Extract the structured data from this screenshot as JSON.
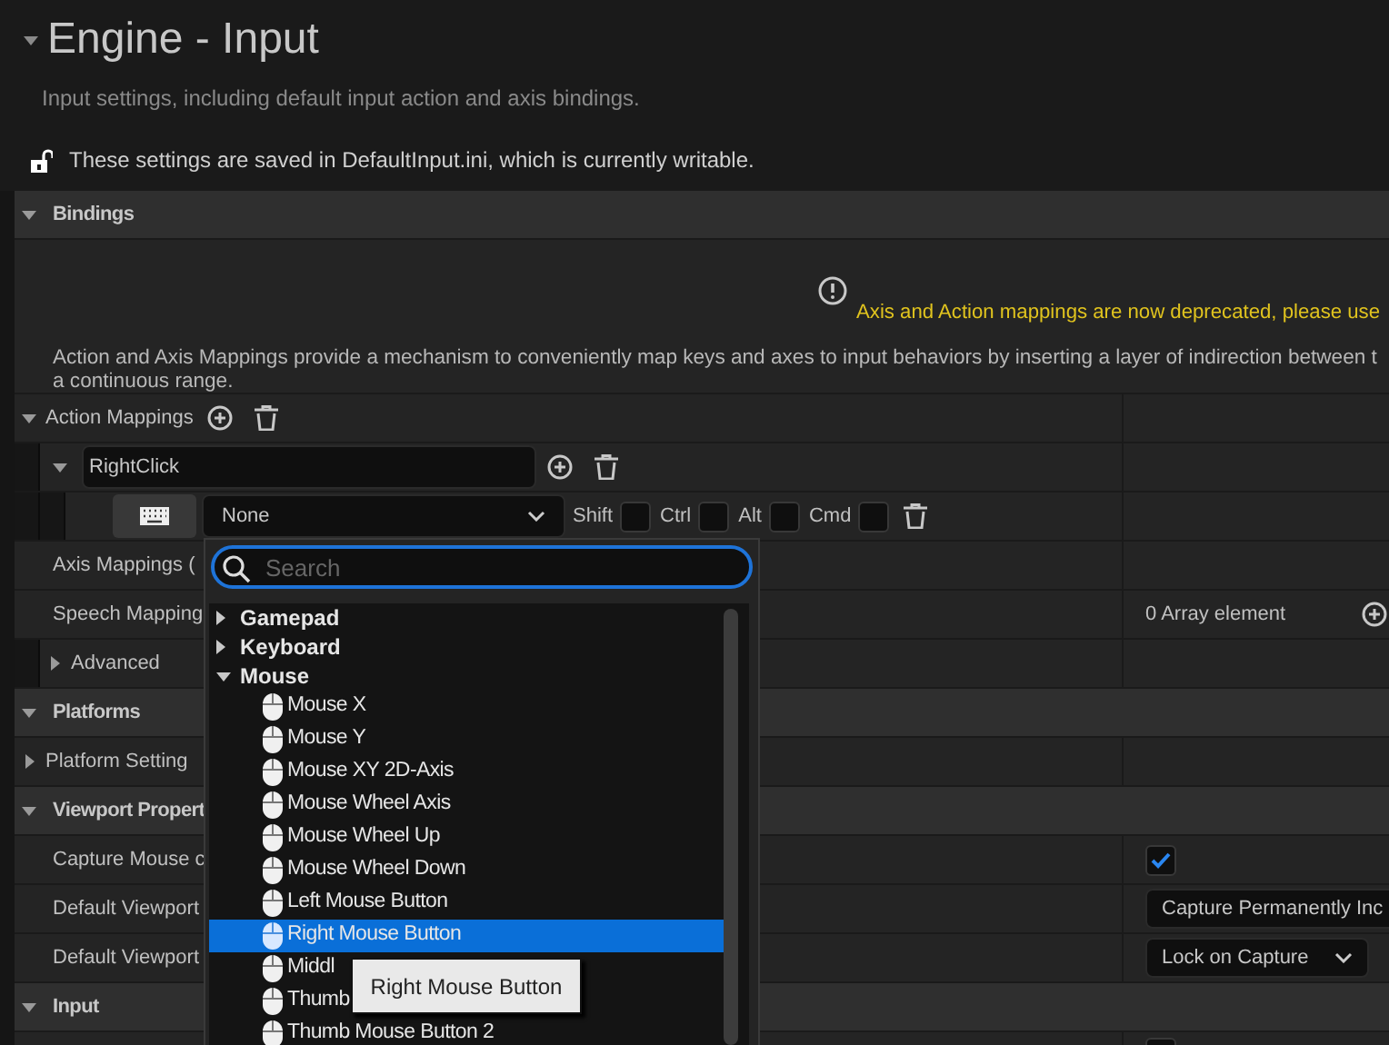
{
  "page": {
    "title": "Engine - Input",
    "expanded": true,
    "description": "Input settings, including default input action and axis bindings.",
    "status": "These settings are saved in DefaultInput.ini, which is currently writable.",
    "locked": false
  },
  "sections": [
    {
      "title": "Bindings",
      "expanded": true,
      "rows": [
        {
          "kind": "notice",
          "warning": "Axis and Action mappings are now deprecated, please use",
          "lines": [
            "Action and Axis Mappings provide a mechanism to conveniently map keys and axes to input behaviors by inserting a layer of indirection between t",
            "a continuous range."
          ]
        },
        {
          "kind": "array_group",
          "label": "Action Mappings",
          "expanded": true,
          "children": [
            {
              "kind": "action",
              "name": "RightClick",
              "expanded": true,
              "children": [
                {
                  "kind": "key",
                  "value": "None",
                  "modifiers": [
                    {
                      "label": "Shift",
                      "checked": false
                    },
                    {
                      "label": "Ctrl",
                      "checked": false
                    },
                    {
                      "label": "Alt",
                      "checked": false
                    },
                    {
                      "label": "Cmd",
                      "checked": false
                    }
                  ]
                }
              ]
            }
          ]
        },
        {
          "kind": "label",
          "label": "Axis Mappings ("
        },
        {
          "kind": "array",
          "label": "Speech Mapping",
          "value": "0 Array element"
        },
        {
          "kind": "advanced",
          "label": "Advanced",
          "expanded": false
        }
      ]
    },
    {
      "title": "Platforms",
      "expanded": true,
      "rows": [
        {
          "kind": "group",
          "label": "Platform Setting",
          "expanded": false
        }
      ]
    },
    {
      "title": "Viewport Propert",
      "expanded": true,
      "rows": [
        {
          "kind": "checkbox",
          "label": "Capture Mouse c",
          "checked": true
        },
        {
          "kind": "dropdown",
          "label": "Default Viewport",
          "value": "Capture Permanently Inc"
        },
        {
          "kind": "dropdown",
          "label": "Default Viewport",
          "value": "Lock on Capture",
          "chevron": true
        }
      ]
    },
    {
      "title": "Input",
      "expanded": true,
      "rows": [
        {
          "kind": "checkbox",
          "checked": false
        }
      ]
    }
  ],
  "key_menu": {
    "placeholder": "Search",
    "categories": [
      {
        "label": "Gamepad",
        "expanded": false
      },
      {
        "label": "Keyboard",
        "expanded": false
      },
      {
        "label": "Mouse",
        "expanded": true,
        "children": [
          {
            "label": "Mouse X",
            "selected": false
          },
          {
            "label": "Mouse Y",
            "selected": false
          },
          {
            "label": "Mouse XY 2D-Axis",
            "selected": false
          },
          {
            "label": "Mouse Wheel Axis",
            "selected": false
          },
          {
            "label": "Mouse Wheel Up",
            "selected": false
          },
          {
            "label": "Mouse Wheel Down",
            "selected": false
          },
          {
            "label": "Left Mouse Button",
            "selected": false
          },
          {
            "label": "Right Mouse Button",
            "selected": true
          },
          {
            "label": "Middl",
            "selected": false
          },
          {
            "label": "Thumb",
            "selected": false
          },
          {
            "label": "Thumb Mouse Button 2",
            "selected": false
          }
        ]
      }
    ]
  },
  "tooltip": "Right Mouse Button"
}
